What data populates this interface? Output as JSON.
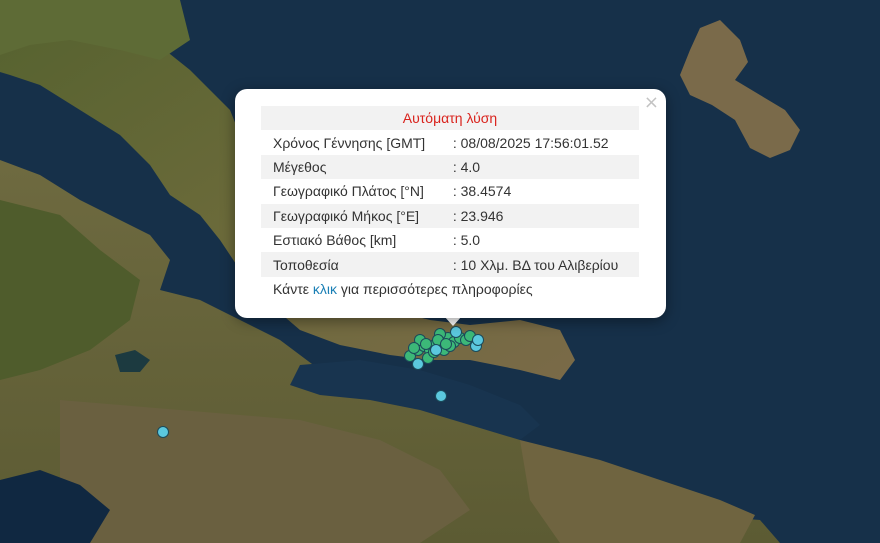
{
  "popup": {
    "title": "Αυτόματη λύση",
    "close": "×",
    "rows": [
      {
        "label": "Χρόνος Γέννησης [GMT]",
        "value": ": 08/08/2025 17:56:01.52"
      },
      {
        "label": "Μέγεθος",
        "value": ": 4.0"
      },
      {
        "label": "Γεωγραφικό Πλάτος [°N]",
        "value": ": 38.4574"
      },
      {
        "label": "Γεωγραφικό Μήκος [°E]",
        "value": ": 23.946"
      },
      {
        "label": "Εστιακό Βάθος [km]",
        "value": ": 5.0"
      },
      {
        "label": "Τοποθεσία",
        "value": ": 10 Χλμ. ΒΔ του Αλιβερίου"
      }
    ],
    "footer": {
      "before": "Κάντε ",
      "link": "κλικ",
      "after": " για περισσότερες πληροφορίες"
    }
  },
  "colors": {
    "green_marker": "#3cb878",
    "cyan_marker": "#5bc8de",
    "title_red": "#d9231d",
    "link_blue": "#1a7fb5",
    "sea": "#163049"
  },
  "markers": {
    "count": 28
  }
}
